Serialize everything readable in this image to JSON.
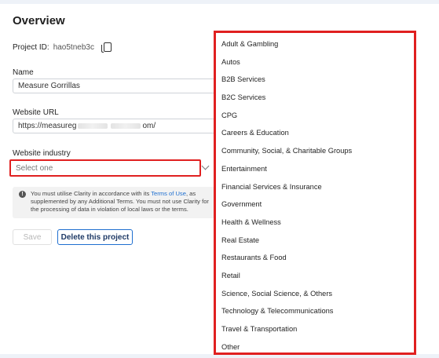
{
  "overview": {
    "title": "Overview",
    "project_id_label": "Project ID:",
    "project_id_value": "hao5tneb3c",
    "name_label": "Name",
    "name_value": "Measure Gorrillas",
    "url_label": "Website URL",
    "url_prefix": "https://measureg",
    "url_suffix": "om/",
    "industry_label": "Website industry",
    "industry_placeholder": "Select one",
    "notice_before": "You must utilise Clarity in accordance with its ",
    "notice_link": "Terms of Use",
    "notice_after": ", as supplemented by any Additional Terms. You must not use Clarity for the processing of data in violation of local laws or the terms.",
    "save_label": "Save",
    "delete_label": "Delete this project"
  },
  "dropdown": {
    "options": [
      "Adult & Gambling",
      "Autos",
      "B2B Services",
      "B2C Services",
      "CPG",
      "Careers & Education",
      "Community, Social, & Charitable Groups",
      "Entertainment",
      "Financial Services & Insurance",
      "Government",
      "Health & Wellness",
      "Real Estate",
      "Restaurants & Food",
      "Retail",
      "Science, Social Science, & Others",
      "Technology & Telecommunications",
      "Travel & Transportation",
      "Other"
    ]
  },
  "colors": {
    "highlight": "#e02020",
    "link": "#1f6fd0"
  }
}
